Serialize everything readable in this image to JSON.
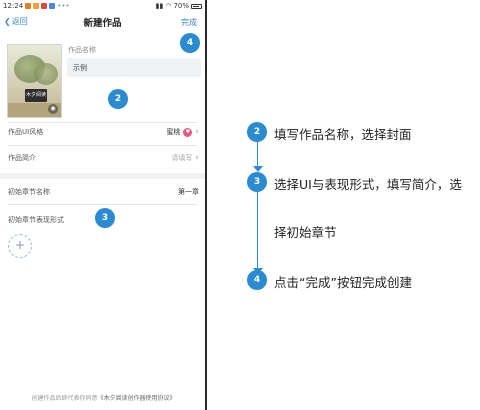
{
  "status_bar": {
    "time": "12:24",
    "battery": "70%"
  },
  "nav": {
    "back_label": "返回",
    "title": "新建作品",
    "done_label": "完成"
  },
  "cover": {
    "logo_text": "木夕阅读"
  },
  "work_name": {
    "label": "作品名称",
    "value": "示例"
  },
  "rows": {
    "ui_style": {
      "label": "作品UI风格",
      "value": "蜜桃"
    },
    "intro": {
      "label": "作品简介",
      "hint": "请填写"
    },
    "chapter_name": {
      "label": "初始章节名称",
      "value": "第一章"
    },
    "chapter_form": {
      "label": "初始章节表现形式"
    }
  },
  "add_button": {
    "symbol": "+"
  },
  "footer": {
    "prefix": "创建作品后即代表你同意",
    "agreement": "《木夕阅读创作器使用协议》"
  },
  "callouts": [
    "4",
    "2",
    "3"
  ],
  "steps": [
    {
      "num": "2",
      "text": "填写作品名称，选择封面"
    },
    {
      "num": "3",
      "text": "选择UI与表现形式，填写简介，选"
    },
    {
      "num": "",
      "text": "择初始章节"
    },
    {
      "num": "4",
      "text": "点击“完成”按钮完成创建"
    }
  ],
  "colors": {
    "accent": "#2a8bd0",
    "link": "#3a86d4",
    "input_bg": "#eef2f5"
  }
}
